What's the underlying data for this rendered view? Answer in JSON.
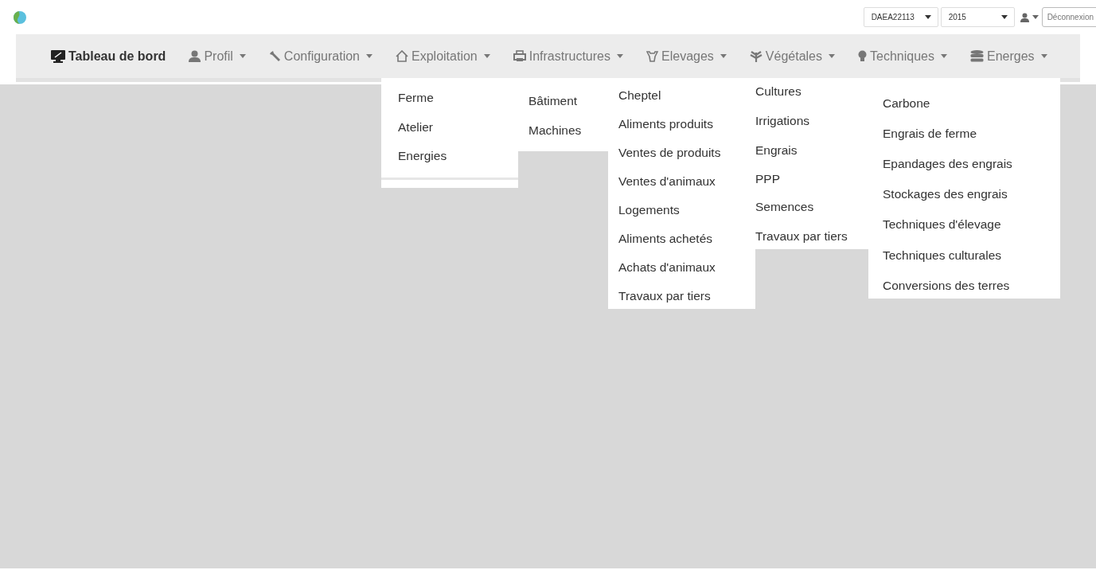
{
  "header": {
    "selects": [
      {
        "value": "DAEA22113"
      },
      {
        "value": "2015"
      }
    ],
    "logout": "Déconnexion"
  },
  "nav": {
    "items": [
      {
        "label": "Tableau de bord",
        "selected": true,
        "dropdown": false
      },
      {
        "label": "Profil",
        "selected": false,
        "dropdown": true
      },
      {
        "label": "Configuration",
        "selected": false,
        "dropdown": true
      },
      {
        "label": "Exploitation",
        "selected": false,
        "dropdown": true
      },
      {
        "label": "Infrastructures",
        "selected": false,
        "dropdown": true
      },
      {
        "label": "Elevages",
        "selected": false,
        "dropdown": true
      },
      {
        "label": "Végétales",
        "selected": false,
        "dropdown": true
      },
      {
        "label": "Techniques",
        "selected": false,
        "dropdown": true
      },
      {
        "label": "Energes",
        "selected": false,
        "dropdown": true
      }
    ]
  },
  "open_menus": [
    {
      "items": [
        "Ferme",
        "Atelier",
        "Energies"
      ]
    },
    {
      "items": [
        "Bâtiment",
        "Machines"
      ]
    },
    {
      "items": [
        "Cheptel",
        "Aliments produits",
        "Ventes de produits",
        "Ventes d'animaux",
        "Logements",
        "Aliments achetés",
        "Achats d'animaux",
        "Travaux par tiers"
      ]
    },
    {
      "items": [
        "Cultures",
        "Irrigations",
        "Engrais",
        "PPP",
        "Semences",
        "Travaux par tiers"
      ]
    },
    {
      "items": [
        "Carbone",
        "Engrais de ferme",
        "Epandages des engrais",
        "Stockages des engrais",
        "Techniques d'élevage",
        "Techniques culturales",
        "Conversions des terres"
      ]
    }
  ]
}
